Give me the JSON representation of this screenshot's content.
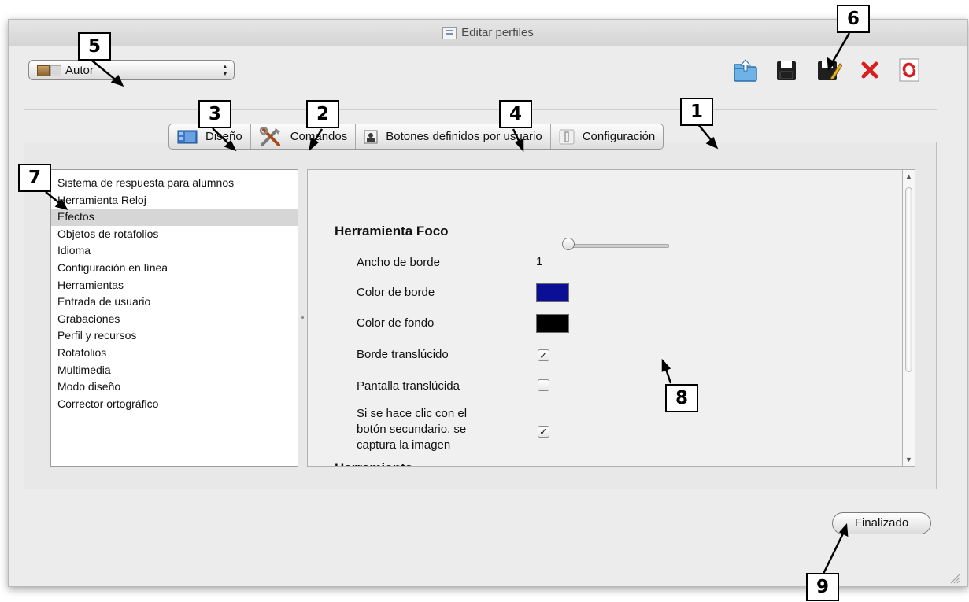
{
  "window": {
    "title": "Editar perfiles"
  },
  "profile_select": {
    "value": "Autor"
  },
  "toolbar": {
    "icons": [
      "import-profile-icon",
      "save-icon",
      "save-as-icon",
      "delete-icon",
      "refresh-icon"
    ],
    "colors": {
      "save": "#1f1f1f",
      "delete": "#d81f1f",
      "refresh": "#d81f1f",
      "import": "#4a9ad6"
    }
  },
  "tabs": [
    {
      "label": "Diseño",
      "icon": "design-icon"
    },
    {
      "label": "Comandos",
      "icon": "tools-icon"
    },
    {
      "label": "Botones definidos por usuario",
      "icon": "user-button-icon"
    },
    {
      "label": "Configuración",
      "icon": "settings-icon"
    }
  ],
  "sidebar": {
    "items": [
      "Sistema de respuesta para alumnos",
      "Herramienta Reloj",
      "Efectos",
      "Objetos de rotafolios",
      "Idioma",
      "Configuración en línea",
      "Herramientas",
      "Entrada de usuario",
      "Grabaciones",
      "Perfil y recursos",
      "Rotafolios",
      "Multimedia",
      "Modo diseño",
      "Corrector ortográfico"
    ],
    "selected": "Efectos"
  },
  "settings": {
    "section_title": "Herramienta Foco",
    "border_width_label": "Ancho de borde",
    "border_width_value": "1",
    "border_color_label": "Color de borde",
    "border_color": "#0a0f96",
    "background_color_label": "Color de fondo",
    "background_color": "#000000",
    "translucent_border_label": "Borde translúcido",
    "translucent_border_checked": true,
    "translucent_screen_label": "Pantalla translúcida",
    "translucent_screen_checked": false,
    "right_click_capture_label_line1": "Si se hace clic con el",
    "right_click_capture_label_line2": "botón secundario, se",
    "right_click_capture_label_line3": "captura la imagen",
    "right_click_capture_checked": true,
    "next_section_title": "Herramienta"
  },
  "footer": {
    "done_label": "Finalizado"
  },
  "callouts": [
    "1",
    "2",
    "3",
    "4",
    "5",
    "6",
    "7",
    "8",
    "9"
  ]
}
